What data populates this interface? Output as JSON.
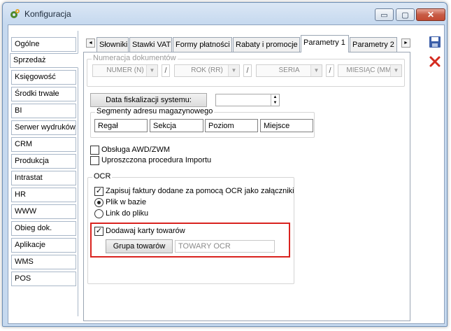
{
  "window": {
    "title": "Konfiguracja"
  },
  "titlebar_buttons": {
    "minimize": "▭",
    "maximize": "▢",
    "close": "✕"
  },
  "nav": {
    "items": [
      "Ogólne",
      "Sprzedaż",
      "Księgowość",
      "Środki trwałe",
      "BI",
      "Serwer wydruków",
      "CRM",
      "Produkcja",
      "Intrastat",
      "HR",
      "WWW",
      "Obieg dok.",
      "Aplikacje",
      "WMS",
      "POS"
    ],
    "active": "Sprzedaż"
  },
  "tabs": {
    "items": [
      "Słowniki",
      "Stawki VAT",
      "Formy płatności",
      "Rabaty i promocje",
      "Parametry 1",
      "Parametry 2"
    ],
    "active": "Parametry 1",
    "prev_arrow": "◄",
    "next_arrow": "►"
  },
  "numeracja": {
    "label": "Numeracja dokumentów",
    "combos": [
      "NUMER (N)",
      "ROK (RR)",
      "SERIA",
      "MIESIĄC (MM)"
    ],
    "separator": "/"
  },
  "data_fiskalizacji": {
    "label": "Data fiskalizacji systemu:",
    "value": ""
  },
  "segmenty": {
    "label": "Segmenty adresu magazynowego",
    "values": [
      "Regał",
      "Sekcja",
      "Poziom",
      "Miejsce"
    ]
  },
  "options": {
    "awd": {
      "label": "Obsługa AWD/ZWM",
      "checked": false
    },
    "import": {
      "label": "Uproszczona procedura Importu",
      "checked": false
    }
  },
  "ocr": {
    "label": "OCR",
    "save_attachments": {
      "label": "Zapisuj faktury dodane za pomocą OCR jako załączniki",
      "checked": true
    },
    "radio_db": {
      "label": "Plik w bazie",
      "selected": true
    },
    "radio_link": {
      "label": "Link do pliku",
      "selected": false
    },
    "add_cards": {
      "label": "Dodawaj karty towarów",
      "checked": true
    },
    "group_button": "Grupa towarów",
    "group_value": "TOWARY OCR"
  },
  "colors": {
    "highlight": "#d9231f",
    "save_icon": "#3b5ea8",
    "delete_icon": "#d42a1f"
  }
}
